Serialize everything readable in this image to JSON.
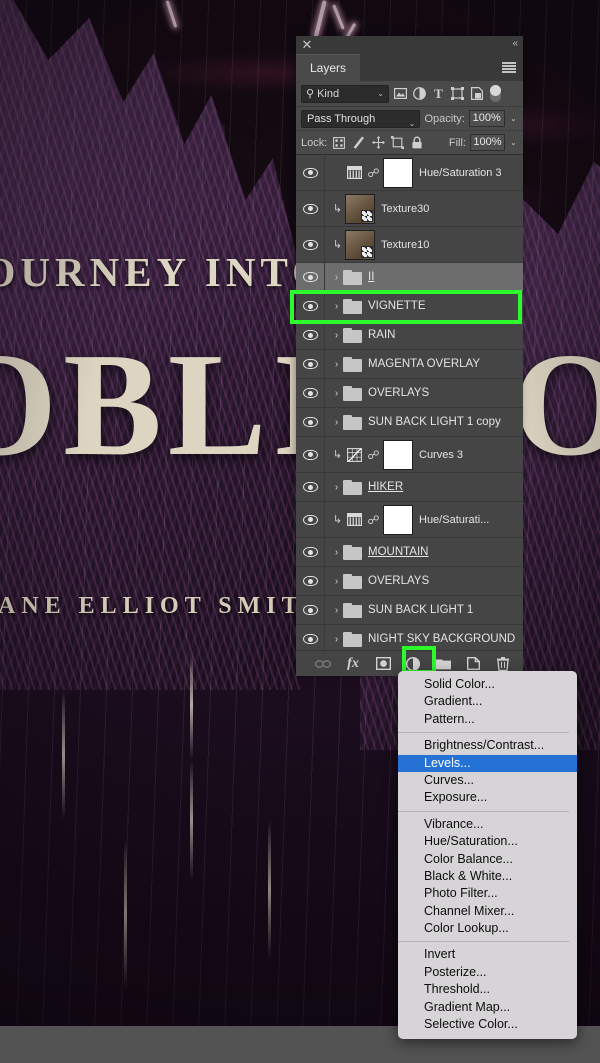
{
  "artwork": {
    "kicker": "JOURNEY INTO",
    "title": "OBLIVION",
    "author": "JANE ELLIOT SMITH"
  },
  "panel": {
    "close_icon": "close-icon",
    "collapse_icon": "«",
    "tab_label": "Layers",
    "menu_icon": "panel-menu-icon",
    "filter": {
      "search_icon": "⌕",
      "kind_label": "Kind",
      "chevron": "⌄",
      "icons": [
        "pixel-filter-icon",
        "adjustment-filter-icon",
        "type-filter-icon",
        "shape-filter-icon",
        "smartobject-filter-icon"
      ],
      "toggle": "filter-enable-toggle"
    },
    "blend": {
      "mode": "Pass Through",
      "opacity_label": "Opacity:",
      "opacity_value": "100%",
      "chevron": "⌄"
    },
    "lock": {
      "label": "Lock:",
      "fill_label": "Fill:",
      "fill_value": "100%",
      "icons": [
        "lock-transparency-icon",
        "lock-image-icon",
        "lock-position-icon",
        "lock-artboard-icon",
        "lock-all-icon"
      ]
    },
    "layers": [
      {
        "name": "Hue/Saturation 3",
        "type": "adjustment",
        "adj": "hue-saturation",
        "visible": true,
        "mask": true,
        "link": true,
        "clipped": false,
        "underline": false,
        "selected": false
      },
      {
        "name": "Texture30",
        "type": "smart",
        "visible": true,
        "clipped": true,
        "underline": false,
        "selected": false
      },
      {
        "name": "Texture10",
        "type": "smart",
        "visible": true,
        "clipped": true,
        "underline": false,
        "selected": false
      },
      {
        "name": "II",
        "type": "group",
        "visible": true,
        "underline": true,
        "selected": true
      },
      {
        "name": "VIGNETTE",
        "type": "group",
        "visible": true,
        "underline": false,
        "selected": false
      },
      {
        "name": "RAIN",
        "type": "group",
        "visible": true,
        "underline": false,
        "selected": false
      },
      {
        "name": "MAGENTA OVERLAY",
        "type": "group",
        "visible": true,
        "underline": false,
        "selected": false
      },
      {
        "name": "OVERLAYS",
        "type": "group",
        "visible": true,
        "underline": false,
        "selected": false
      },
      {
        "name": "SUN BACK LIGHT 1 copy",
        "type": "group",
        "visible": true,
        "underline": false,
        "selected": false
      },
      {
        "name": "Curves 3",
        "type": "adjustment",
        "adj": "curves",
        "visible": true,
        "mask": true,
        "link": true,
        "clipped": true,
        "underline": false,
        "selected": false
      },
      {
        "name": "HIKER",
        "type": "group",
        "visible": true,
        "underline": true,
        "selected": false
      },
      {
        "name": "Hue/Saturati...",
        "type": "adjustment",
        "adj": "hue-saturation",
        "visible": true,
        "mask": true,
        "link": true,
        "clipped": true,
        "underline": false,
        "selected": false
      },
      {
        "name": "MOUNTAIN",
        "type": "group",
        "visible": true,
        "underline": true,
        "selected": false
      },
      {
        "name": "OVERLAYS",
        "type": "group",
        "visible": true,
        "underline": false,
        "selected": false
      },
      {
        "name": "SUN BACK LIGHT 1",
        "type": "group",
        "visible": true,
        "underline": false,
        "selected": false
      },
      {
        "name": "NIGHT SKY BACKGROUND",
        "type": "group",
        "visible": true,
        "underline": false,
        "selected": false
      }
    ],
    "bottom_buttons": [
      {
        "name": "link-layers-button",
        "icon": "∞"
      },
      {
        "name": "layer-styles-button",
        "icon": "fx"
      },
      {
        "name": "add-layer-mask-button",
        "icon": "mask"
      },
      {
        "name": "new-adjustment-layer-button",
        "icon": "adjustment"
      },
      {
        "name": "new-group-button",
        "icon": "folder"
      },
      {
        "name": "new-layer-button",
        "icon": "new"
      },
      {
        "name": "delete-layer-button",
        "icon": "trash"
      }
    ]
  },
  "adjustment_menu": {
    "groups": [
      [
        "Solid Color...",
        "Gradient...",
        "Pattern..."
      ],
      [
        "Brightness/Contrast...",
        "Levels...",
        "Curves...",
        "Exposure..."
      ],
      [
        "Vibrance...",
        "Hue/Saturation...",
        "Color Balance...",
        "Black & White...",
        "Photo Filter...",
        "Channel Mixer...",
        "Color Lookup..."
      ],
      [
        "Invert",
        "Posterize...",
        "Threshold...",
        "Gradient Map...",
        "Selective Color..."
      ]
    ],
    "highlighted": "Levels..."
  },
  "colors": {
    "highlight_green": "#2dfa2d",
    "menu_selection_blue": "#2572d6",
    "panel_bg": "#393939",
    "layer_row_bg": "#454545",
    "selected_row_bg": "#6d6d6d"
  }
}
